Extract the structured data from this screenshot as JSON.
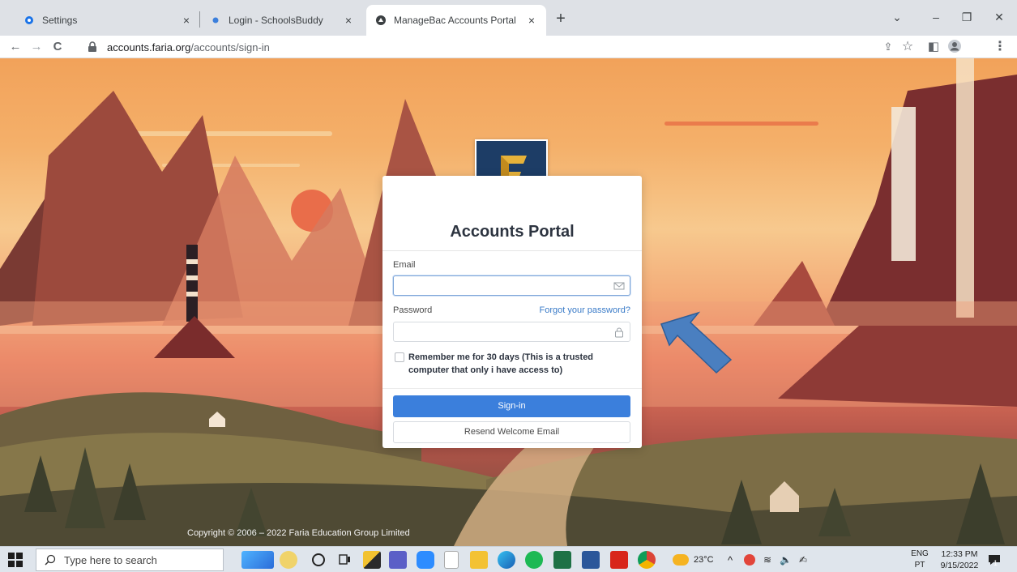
{
  "browser": {
    "tabs": [
      {
        "title": "Settings",
        "icon": "gear-icon",
        "active": false
      },
      {
        "title": "Login - SchoolsBuddy",
        "icon": "dot-icon",
        "active": false
      },
      {
        "title": "ManageBac Accounts Portal",
        "icon": "managebac-icon",
        "active": true
      }
    ],
    "tab_close": "×",
    "new_tab": "+",
    "window_controls": {
      "chevron": "⌄",
      "minimize": "–",
      "restore": "❐",
      "close": "✕"
    },
    "nav": {
      "back": "←",
      "forward": "→",
      "reload": "C"
    },
    "url_host": "accounts.faria.org",
    "url_path": "/accounts/sign-in",
    "toolbar_icons": {
      "share": "⇪",
      "star": "☆",
      "sidepanel": "◧",
      "menu": "⋮"
    }
  },
  "login": {
    "title": "Accounts Portal",
    "email_label": "Email",
    "email_value": "",
    "password_label": "Password",
    "forgot_link": "Forgot your password?",
    "password_value": "",
    "remember_label": "Remember me for 30 days (This is a trusted computer that only i have access to)",
    "remember_checked": false,
    "signin_button": "Sign-in",
    "resend_button": "Resend Welcome Email",
    "logo_letter": "F"
  },
  "footer": {
    "copyright": "Copyright © 2006 – 2022 Faria Education Group Limited"
  },
  "taskbar": {
    "search_placeholder": "Type here to search",
    "weather": "23°C",
    "lang_line1": "ENG",
    "lang_line2": "PT",
    "time": "12:33 PM",
    "date": "9/15/2022",
    "notifications": "1"
  },
  "colors": {
    "primary_button": "#3b7fdc",
    "link": "#3a7bc8",
    "logo_bg": "#1d3d66",
    "arrow": "#4a7fc0"
  }
}
